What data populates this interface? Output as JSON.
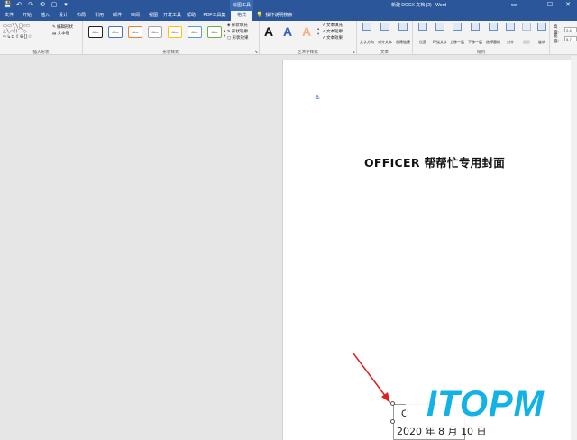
{
  "titlebar": {
    "quick_access": [
      "💾",
      "↶",
      "↷",
      "⟲",
      "▢",
      "▾"
    ],
    "context_tab_label": "绘图工具",
    "document_title": "新建 DOCX 文档 (2) - Word",
    "window_controls": [
      "▭",
      "—",
      "☐",
      "✕"
    ]
  },
  "tabs": [
    {
      "label": "文件"
    },
    {
      "label": "开始"
    },
    {
      "label": "插入"
    },
    {
      "label": "设计"
    },
    {
      "label": "布局"
    },
    {
      "label": "引用"
    },
    {
      "label": "邮件"
    },
    {
      "label": "审阅"
    },
    {
      "label": "视图"
    },
    {
      "label": "开发工具"
    },
    {
      "label": "帮助"
    },
    {
      "label": "PDF工具集"
    },
    {
      "label": "格式"
    }
  ],
  "tell_me": "操作说明搜索",
  "ribbon": {
    "insert_shapes": {
      "shape_glyphs": "▭▭╲╲▢○□\n△╲▱⟨⟩⌒◇\n⇨↳⊏⇧⊕{}☆",
      "edit_shape": "编辑形状",
      "text_box": "文本框",
      "label": "插入形状"
    },
    "shape_styles": {
      "boxes": [
        "Abc",
        "Abc",
        "Abc",
        "Abc",
        "Abc",
        "Abc",
        "Abc"
      ],
      "fill": "形状填充",
      "outline": "形状轮廓",
      "effects": "形状效果",
      "label": "形状样式"
    },
    "wordart": {
      "letters": [
        "A",
        "A",
        "A"
      ],
      "text_fill": "文本填充",
      "text_outline": "文本轮廓",
      "text_effects": "文本效果",
      "label": "艺术字样式"
    },
    "text": {
      "direction": "文字方向",
      "align": "对齐文本",
      "link": "创建链接",
      "label": "文本"
    },
    "arrange": {
      "position": "位置",
      "wrap": "环绕文字",
      "forward": "上移一层",
      "backward": "下移一层",
      "pane": "选择窗格",
      "align": "对齐",
      "group": "组合",
      "rotate": "旋转",
      "label": "排列"
    },
    "size": {
      "height_label": "高度:",
      "height_value": "2.4",
      "width_label": "宽度:",
      "width_value": "5.7"
    }
  },
  "document": {
    "anchor": "⚓",
    "cover_title": "OFFICER 帮帮忙专用封面",
    "date_first_char": "C",
    "date_text": "2020 年 8 月 10 日"
  },
  "watermark": "ITOPM",
  "colors": {
    "accent": "#2b579a",
    "arrow": "#e02020",
    "watermark": "#12b2e6"
  }
}
